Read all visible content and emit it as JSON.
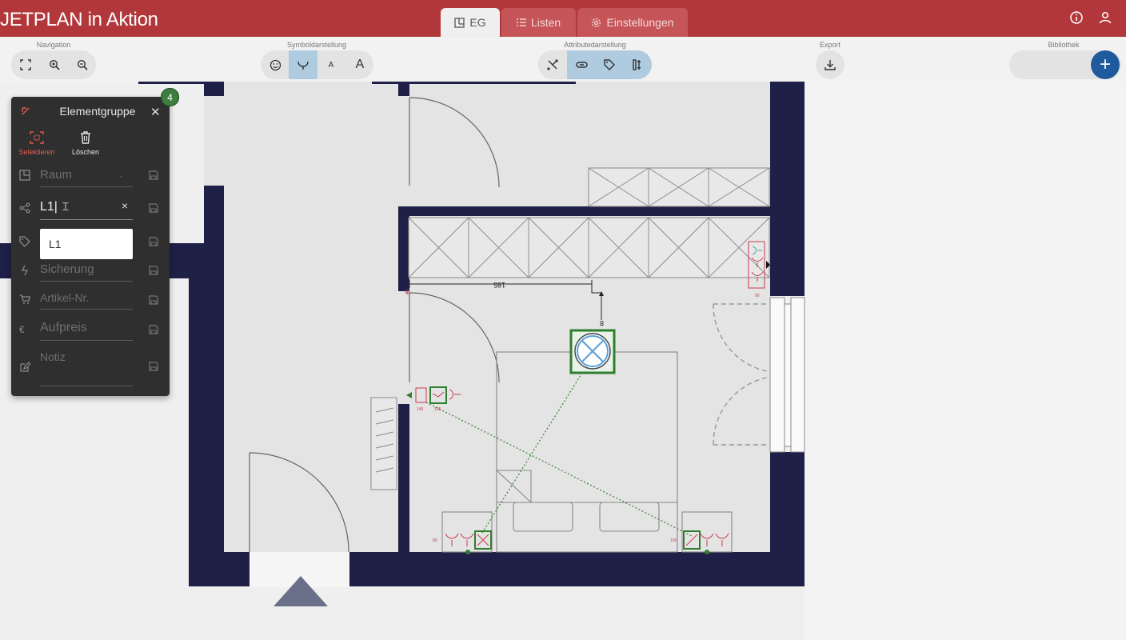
{
  "app": {
    "title": "JETPLAN in Aktion"
  },
  "tabs": [
    {
      "label": "EG",
      "icon": "floorplan-icon",
      "active": true
    },
    {
      "label": "Listen",
      "icon": "list-icon",
      "active": false
    },
    {
      "label": "Einstellungen",
      "icon": "gear-icon",
      "active": false
    }
  ],
  "toolbar": {
    "groups": {
      "navigation": "Navigation",
      "symbol": "Symboldarstellung",
      "attribute": "Attributedarstellung",
      "export": "Export",
      "library": "Bibliothek"
    },
    "symbol_small_a": "A",
    "symbol_large_a": "A",
    "add_label": "+"
  },
  "panel": {
    "title": "Elementgruppe",
    "badge_count": "4",
    "actions": {
      "select": "Selektieren",
      "delete": "Löschen"
    },
    "fields": {
      "room_placeholder": "Raum",
      "circuit_value": "L1",
      "circuit_clear": "×",
      "tag_option": "L1",
      "fuse_placeholder": "Sicherung",
      "article_placeholder": "Artikel-Nr.",
      "surcharge_placeholder": "Aufpreis",
      "note_placeholder": "Notiz"
    }
  },
  "plan": {
    "dimension_label": "185",
    "height_label": "8",
    "outlet_labels": {
      "left": "60",
      "right": "105",
      "switch_left": "145",
      "switch_right": "105",
      "wall": "90"
    }
  },
  "colors": {
    "header": "#b2373a",
    "wall": "#1e2048",
    "accent": "#1f5a9c",
    "selection": "#2f7d2f",
    "symbol": "#c83a4f"
  }
}
